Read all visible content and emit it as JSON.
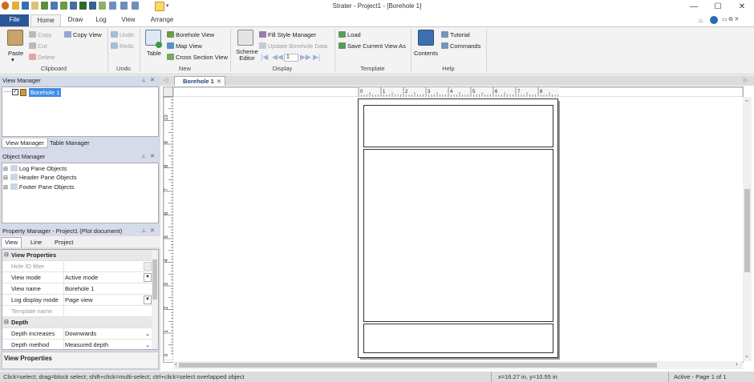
{
  "app": {
    "title": "Strater - Project1 - [Borehole 1]"
  },
  "ribbon_tabs": [
    "File",
    "Home",
    "Draw",
    "Log",
    "View",
    "Arrange"
  ],
  "clipboard": {
    "paste": "Paste",
    "copy": "Copy",
    "cut": "Cut",
    "delete": "Delete",
    "copy_view": "Copy View",
    "group": "Clipboard"
  },
  "undo": {
    "undo": "Undo",
    "redo": "Redo",
    "group": "Undo"
  },
  "new": {
    "table": "Table",
    "borehole_view": "Borehole View",
    "map_view": "Map View",
    "cross_section_view": "Cross Section View",
    "group": "New"
  },
  "display": {
    "scheme_editor": "Scheme Editor",
    "fill_style_manager": "Fill Style Manager",
    "update_borehole_data": "Update Borehole Data",
    "page_value": "1",
    "group": "Display"
  },
  "template": {
    "load": "Load",
    "save_current_view_as": "Save Current View As",
    "group": "Template"
  },
  "help": {
    "contents": "Contents",
    "tutorial": "Tutorial",
    "commands": "Commands",
    "group": "Help"
  },
  "view_manager": {
    "title": "View Manager",
    "item": "Borehole 1",
    "tabs": [
      "View Manager",
      "Table Manager"
    ]
  },
  "object_manager": {
    "title": "Object Manager",
    "items": [
      "Log Pane Objects",
      "Header Pane Objects",
      "Footer Pane Objects"
    ]
  },
  "property_manager": {
    "title": "Property Manager - Project1 (Plot document)",
    "tabs": [
      "View",
      "Line",
      "Project"
    ],
    "categories": {
      "view_properties": "View Properties",
      "depth": "Depth"
    },
    "rows": {
      "hole_id_filter": {
        "name": "Hole ID filter",
        "value": ""
      },
      "view_mode": {
        "name": "View mode",
        "value": "Active mode"
      },
      "view_name": {
        "name": "View name",
        "value": "Borehole 1"
      },
      "log_display_mode": {
        "name": "Log display mode",
        "value": "Page view"
      },
      "template_name": {
        "name": "Template name",
        "value": ""
      },
      "depth_increases": {
        "name": "Depth increases",
        "value": "Downwards"
      },
      "depth_method": {
        "name": "Depth method",
        "value": "Measured depth"
      }
    },
    "footer": "View Properties"
  },
  "document": {
    "tab": "Borehole 1",
    "h_ruler": [
      "0",
      "1",
      "2",
      "3",
      "4",
      "5",
      "6",
      "7",
      "8"
    ],
    "v_ruler": [
      "10",
      "9",
      "8",
      "7",
      "6",
      "5",
      "4",
      "3",
      "2",
      "1",
      "0"
    ]
  },
  "status": {
    "hint": "Click=select; drag=block select; shift+click=multi-select; ctrl+click=select overlapped object",
    "coords": "x=16.27 in, y=10.55 in",
    "page": "Active - Page 1 of 1"
  },
  "colors": {
    "accent": "#2b579a",
    "panel_header": "#d6dbe9"
  }
}
